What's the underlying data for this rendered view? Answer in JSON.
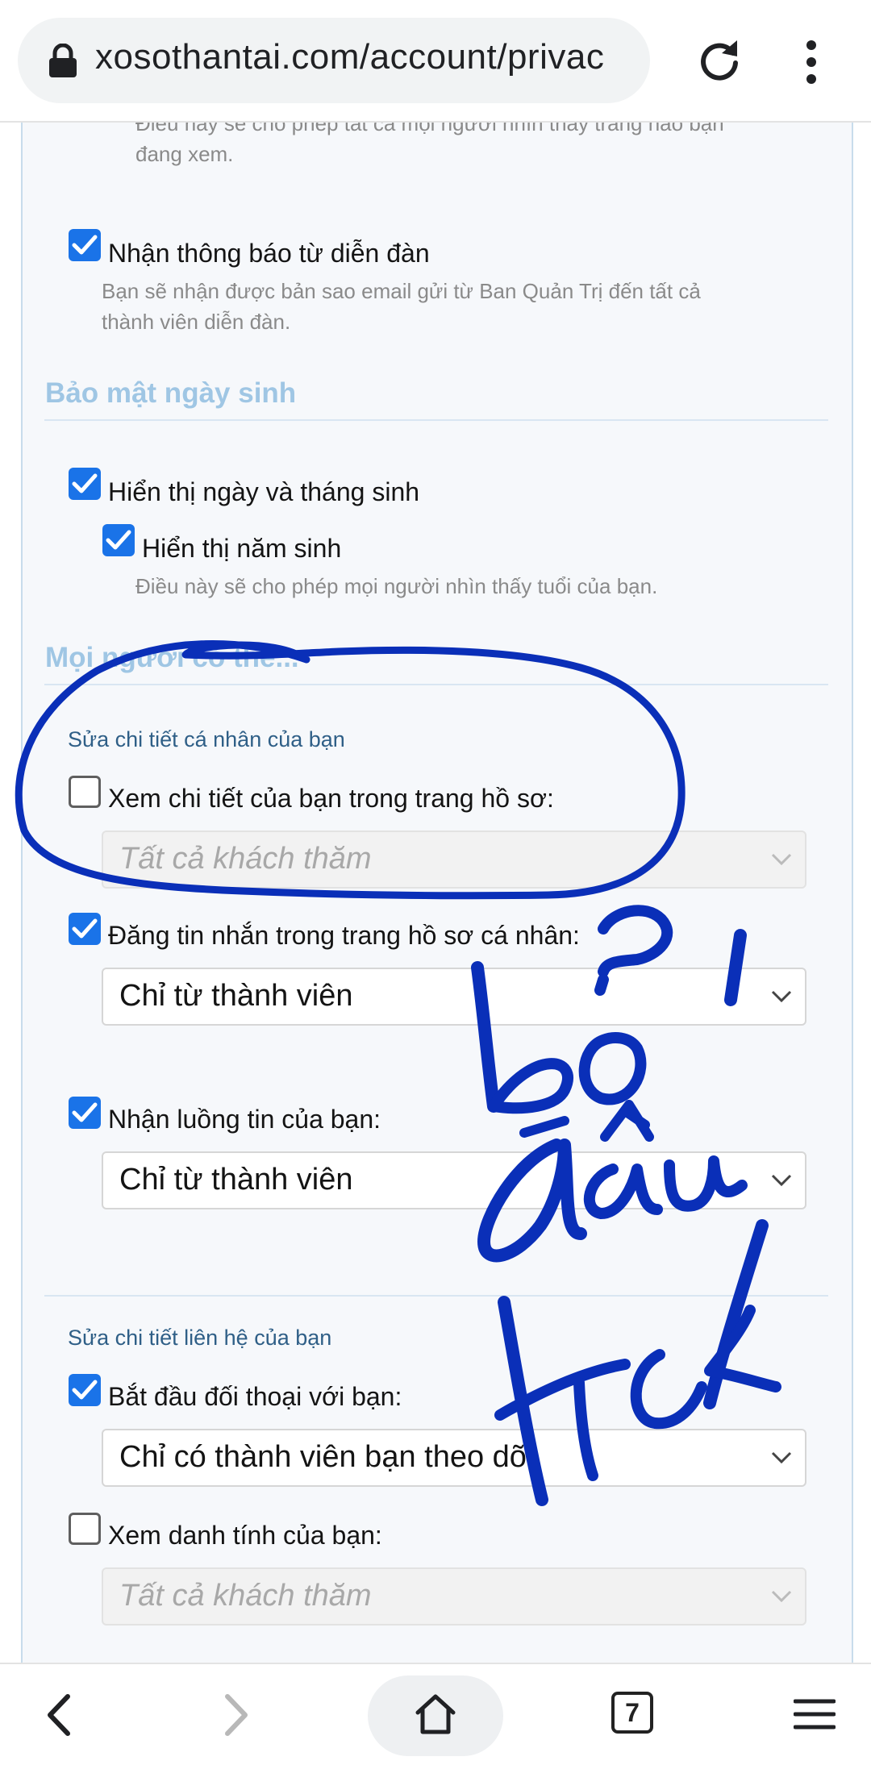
{
  "browser": {
    "url": "xosothantai.com/account/privac",
    "tab_count": "7",
    "icons": [
      "lock-icon",
      "reload-icon",
      "more-vert-icon",
      "back-icon",
      "forward-icon",
      "home-icon",
      "tabs-icon",
      "menu-icon"
    ]
  },
  "content": {
    "top_hint_line1": "Điều này sẽ cho phép tất cả mọi người nhìn thấy trang nào bạn",
    "top_hint_line2": "đang xem.",
    "receive_notice": {
      "label": "Nhận thông báo từ diễn đàn",
      "checked": true,
      "hint_line1": "Bạn sẽ nhận được bản sao email gửi từ Ban Quản Trị đến tất cả",
      "hint_line2": "thành viên diễn đàn."
    },
    "birthday_heading": "Bảo mật ngày sinh",
    "show_day_month": {
      "label": "Hiển thị ngày và tháng sinh",
      "checked": true
    },
    "show_year": {
      "label": "Hiển thị năm sinh",
      "checked": true,
      "hint": "Điều này sẽ cho phép mọi người nhìn thấy tuổi của bạn."
    },
    "everyone_heading": "Mọi người có thể...",
    "personal_group": "Sửa chi tiết cá nhân của bạn",
    "view_details": {
      "label": "Xem chi tiết của bạn trong trang hồ sơ:",
      "checked": false,
      "select": "Tất cả khách thăm"
    },
    "post_messages": {
      "label": "Đăng tin nhắn trong trang hồ sơ cá nhân:",
      "checked": true,
      "select": "Chỉ từ thành viên"
    },
    "receive_feed": {
      "label": "Nhận luồng tin của bạn:",
      "checked": true,
      "select": "Chỉ từ thành viên"
    },
    "contact_group": "Sửa chi tiết liên hệ của bạn",
    "start_conversation": {
      "label": "Bắt đầu đối thoại với bạn:",
      "checked": true,
      "select": "Chỉ có thành viên bạn theo dõi"
    },
    "view_identity": {
      "label": "Xem danh tính của bạn:",
      "checked": false,
      "select": "Tất cả khách thăm"
    }
  },
  "annotation": {
    "color": "#0a2fb8",
    "handwritten_text": "bỏ dấu tick ?"
  },
  "colors": {
    "checkbox_checked": "#1a73e8",
    "heading": "#9fc6e4",
    "group_title": "#2f5f87",
    "panel_bg": "#f6f8fb"
  }
}
